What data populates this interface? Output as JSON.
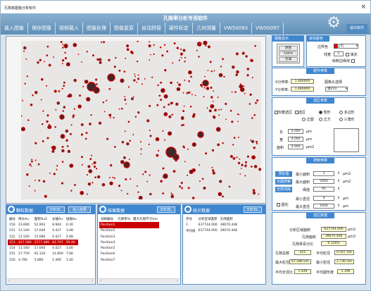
{
  "window": {
    "title": "孔隙率图像分析软件",
    "close": "×"
  },
  "header": {
    "app_title": "孔隙率分析专用软件",
    "menu": [
      "装入图像",
      "保存图像",
      "视频载入",
      "图像处理",
      "图像复原",
      "自动拼接",
      "硬件标定",
      "几何测量",
      "VW50093",
      "VW50097"
    ],
    "exit_label": "退出软件"
  },
  "image_display": {
    "header": "图像显示",
    "buttons": [
      "原图",
      "100%",
      "充满"
    ]
  },
  "target_color": {
    "header": "目标颜色",
    "edge_color_label": "边界色",
    "edge_color_value": "红",
    "thickness_label": "线宽",
    "thickness_value": "1",
    "fill_label": "填充",
    "reprocess_label": "绘制边缘线"
  },
  "hardware": {
    "header": "硬件参数",
    "x_label": "X分辨率:",
    "x_value": "1.480000",
    "y_label": "Y分辨率:",
    "y_value": "1.480000",
    "lens_label": "图像头选择",
    "lens_value": "镜310"
  },
  "region": {
    "header": "选区参数",
    "opts": [
      "仅删选区",
      "选区",
      "矩形",
      "多边形",
      "正圆",
      "正方",
      "三角形"
    ],
    "length_label": "长",
    "length_value": "0.000",
    "width_label": "宽",
    "width_value": "0.000",
    "area_label": "面积",
    "area_value": "0.000",
    "unit_um": "μm",
    "unit_um2": "μm2"
  },
  "search": {
    "header": "搜索参数",
    "buttons": [
      "预处理",
      "全图搜索",
      "全部清除"
    ],
    "min_area_label": "最小面积",
    "min_area_value": "1",
    "max_area_label": "最大面积",
    "max_area_value": "5000",
    "threshold_label": "阈值",
    "threshold_value": "95",
    "min_diam_label": "最小直径",
    "min_diam_value": "0",
    "max_diam_label": "最大直径",
    "max_diam_value": "1000",
    "watershed_label": "圆化",
    "unit_um2": "μm2",
    "unit_um": "μm"
  },
  "pores_panel": {
    "title": "颗粒数据",
    "excel": "EXCEL",
    "add_btn": "加入结果",
    "columns": [
      "编号",
      "周长Au",
      "面积Ou2",
      "长轴Au",
      "短轴Au"
    ],
    "rows": [
      [
        "150",
        "23.680",
        "52.903",
        "8.964",
        "6.30"
      ],
      [
        "151",
        "11.540",
        "17.640",
        "4.427",
        "3.08"
      ],
      [
        "152",
        "11.540",
        "15.680",
        "4.427",
        "2.68"
      ],
      [
        "153",
        "427.580",
        "2577.480",
        "62.707",
        "95.46"
      ],
      [
        "154",
        "11.540",
        "17.640",
        "4.427",
        "3.00"
      ],
      [
        "155",
        "27.759",
        "92.120",
        "14.800",
        "7.86"
      ],
      [
        "156",
        "4.780",
        "5.880",
        "1.406",
        "1.40"
      ]
    ],
    "selected_row": 3
  },
  "results_panel": {
    "title": "结果数据",
    "excel": "EXCEL",
    "columns": [
      "试样编号",
      "孔隙率%",
      "最大孔隙尺寸Um"
    ],
    "rows": [
      [
        "Position1",
        "",
        ""
      ],
      [
        "Position2",
        "",
        ""
      ],
      [
        "Position3",
        "",
        ""
      ],
      [
        "Position4",
        "",
        ""
      ],
      [
        "Position5",
        "",
        ""
      ],
      [
        "Position6",
        "",
        ""
      ],
      [
        "Position7",
        "",
        ""
      ]
    ],
    "selected_row": 0
  },
  "stats_panel": {
    "title": "统计数据",
    "excel": "EXCEL",
    "columns": [
      "序号",
      "分析区域面积",
      "孔隙面积"
    ],
    "rows": [
      [
        "1",
        "637744.000",
        "39070.448"
      ],
      [
        "平均值",
        "637744.000",
        "39070.448"
      ]
    ]
  },
  "analysis": {
    "header": "选区数据",
    "total_area_label": "分析区域面积",
    "total_area_value": "637744.000",
    "pore_area_label": "孔隙面积",
    "pore_area_value": "39070.448",
    "porosity_label": "孔隙率百分比",
    "porosity_value": "6.126%",
    "count_label": "孔隙总数",
    "count_value": "421",
    "avg_diam_label": "平均粒径",
    "avg_diam_value": "0.547 Um",
    "max_diam_label": "最大粒径",
    "max_diam_value": "67.286 Um",
    "min_diam_label": "最小粒径",
    "min_diam_value": "2.736 Um",
    "avg_ratio_label": "平均长径比",
    "avg_ratio_value": "1.449",
    "avg_round_label": "平均圆形度",
    "avg_round_value": "1.196",
    "unit_um2": "μm2"
  },
  "colors": {
    "accent": "#3f86d0",
    "pore_edge": "#c80000",
    "field": "#ffffcc"
  }
}
